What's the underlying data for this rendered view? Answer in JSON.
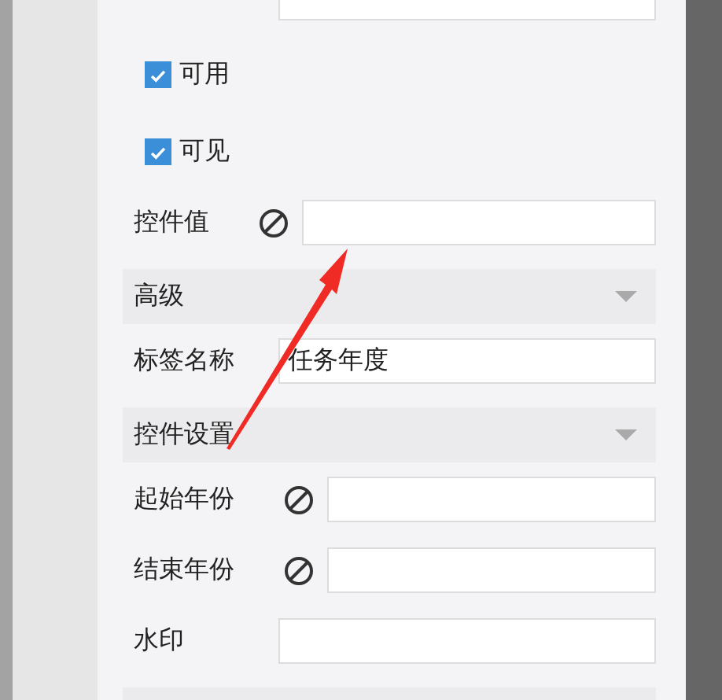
{
  "rows": [
    {
      "kind": "field"
    },
    {
      "kind": "checkbox",
      "label": "可用",
      "checked": true
    },
    {
      "kind": "checkbox",
      "label": "可见",
      "checked": true
    },
    {
      "kind": "nullable",
      "label": "控件值"
    },
    {
      "kind": "section",
      "title": "高级",
      "expanded": true
    },
    {
      "kind": "field",
      "label": "标签名称",
      "value": "任务年度"
    },
    {
      "kind": "section",
      "title": "控件设置",
      "expanded": true
    },
    {
      "kind": "nullable",
      "label": "起始年份"
    },
    {
      "kind": "nullable",
      "label": "结束年份"
    },
    {
      "kind": "field",
      "label": "水印"
    },
    {
      "kind": "section"
    }
  ]
}
